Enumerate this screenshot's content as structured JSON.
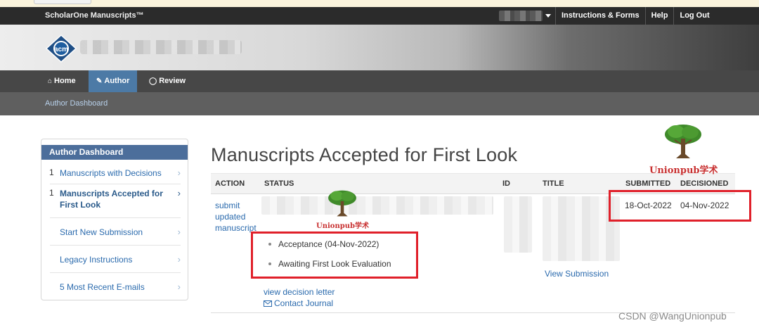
{
  "app": {
    "name": "ScholarOne Manuscripts™"
  },
  "topbar": {
    "links": [
      {
        "label": "Instructions & Forms"
      },
      {
        "label": "Help"
      },
      {
        "label": "Log Out"
      }
    ]
  },
  "banner": {
    "logo_text": "acm"
  },
  "nav": {
    "tabs": [
      {
        "label": "Home",
        "icon": "home-icon",
        "active": false
      },
      {
        "label": "Author",
        "icon": "pencil-icon",
        "active": true
      },
      {
        "label": "Review",
        "icon": "speech-bubble-icon",
        "active": false
      }
    ]
  },
  "breadcrumb": {
    "label": "Author Dashboard"
  },
  "sidebar": {
    "title": "Author Dashboard",
    "items": [
      {
        "count": "1",
        "label": "Manuscripts with Decisions",
        "selected": false
      },
      {
        "count": "1",
        "label": "Manuscripts Accepted for First Look",
        "selected": true
      },
      {
        "count": "",
        "label": "Start New Submission",
        "selected": false
      },
      {
        "count": "",
        "label": "Legacy Instructions",
        "selected": false
      },
      {
        "count": "",
        "label": "5 Most Recent E-mails",
        "selected": false
      }
    ]
  },
  "main": {
    "title": "Manuscripts Accepted for First Look",
    "columns": [
      "ACTION",
      "STATUS",
      "ID",
      "TITLE",
      "SUBMITTED",
      "DECISIONED"
    ],
    "row": {
      "action_lines": [
        "submit",
        "updated",
        "manuscript"
      ],
      "status_items": [
        "Acceptance (04-Nov-2022)",
        "Awaiting First Look Evaluation"
      ],
      "submitted": "18-Oct-2022",
      "decisioned": "04-Nov-2022",
      "view_submission": "View Submission",
      "view_decision_letter": "view decision letter",
      "contact_journal": "Contact Journal"
    }
  },
  "watermark": {
    "text": "Unionpub学术",
    "footer": "CSDN @WangUnionpub"
  },
  "colors": {
    "accent": "#4c7aa6",
    "link": "#2a6aad",
    "highlight": "#e0202a",
    "sidebar_header": "#4c6e9b"
  }
}
